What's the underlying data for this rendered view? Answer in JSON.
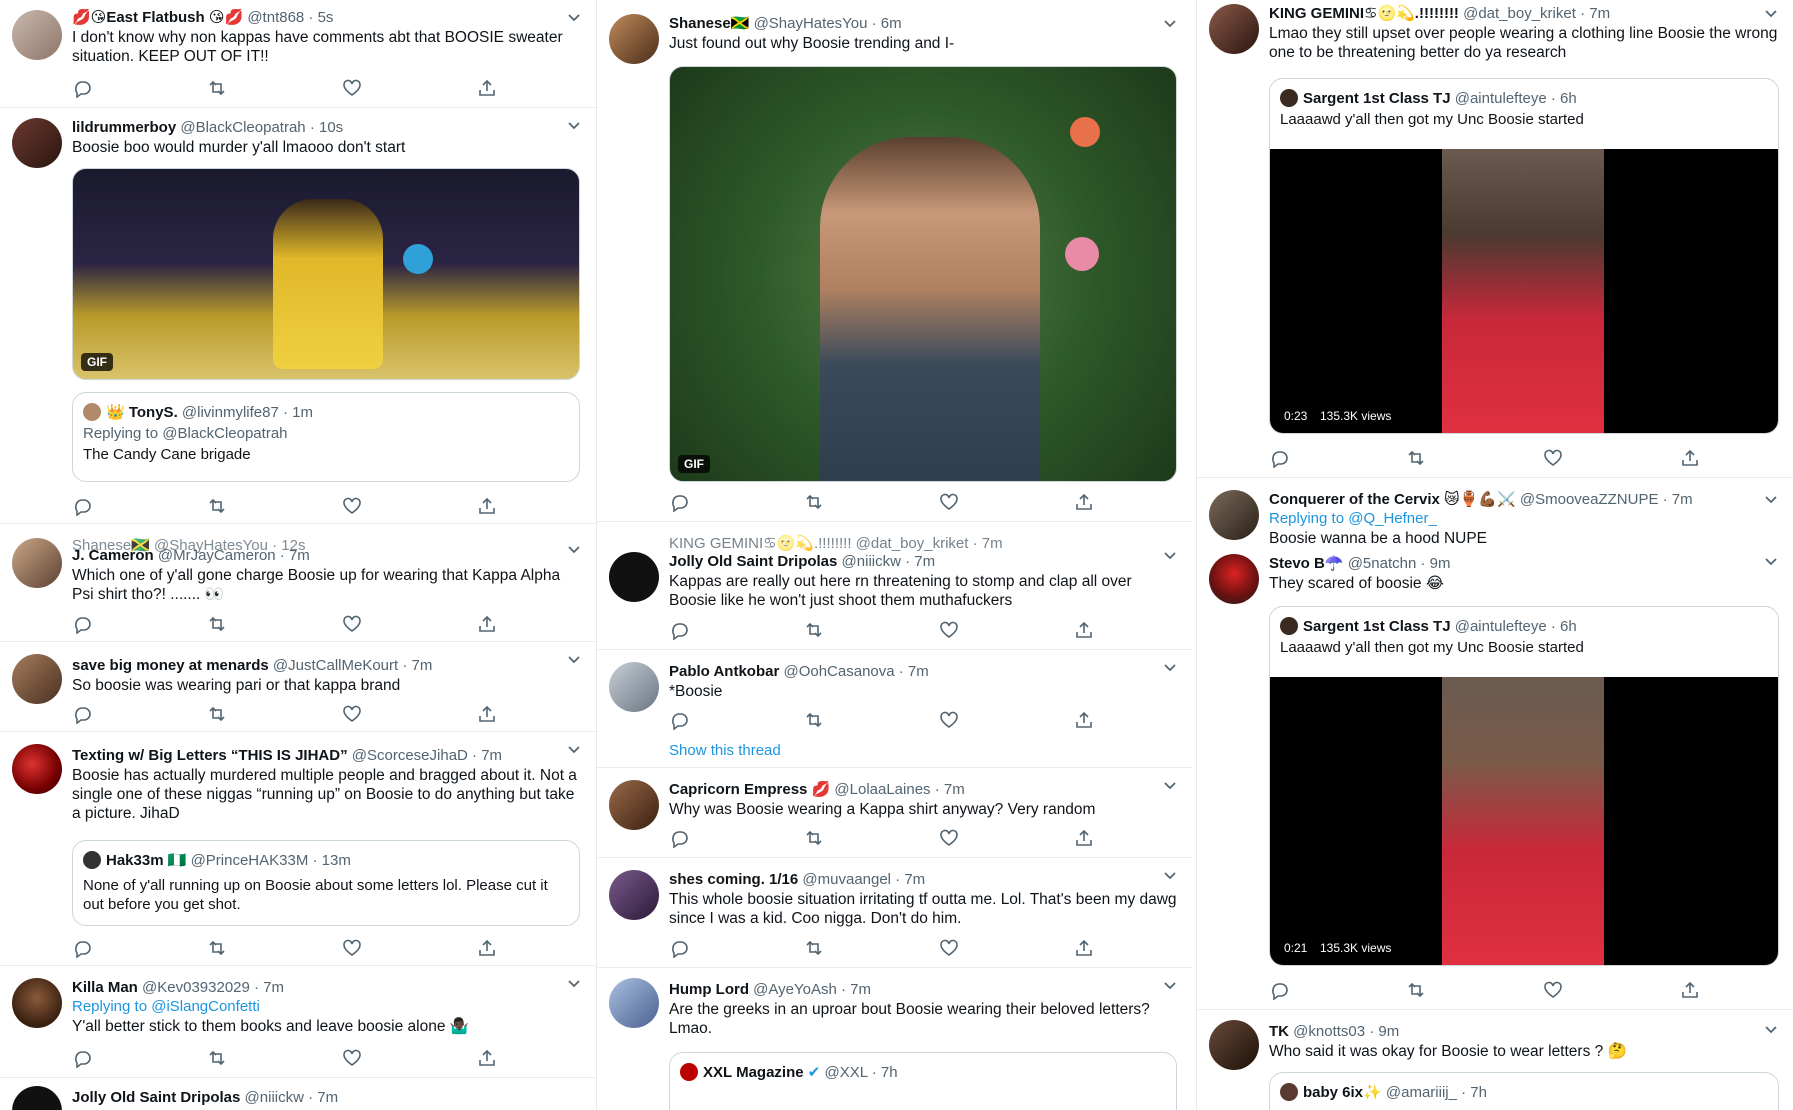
{
  "actions": {
    "reply": "reply-icon",
    "retweet": "retweet-icon",
    "like": "heart-icon",
    "share": "share-icon"
  },
  "colors": {
    "link": "#1b95e0",
    "muted": "#536471",
    "border": "#e6ecf0",
    "text": "#0f1419"
  },
  "col0": {
    "t1": {
      "name": "💋😘East Flatbush 😘💋",
      "handle": "@tnt868 · 5s",
      "text": "I don't know why non kappas have comments abt that BOOSIE sweater situation.  KEEP OUT OF IT!!"
    },
    "t2": {
      "name": "lildrummerboy",
      "handle": "@BlackCleopatrah · 10s",
      "text": "Boosie boo would murder y'all lmaooo don't start",
      "gif": "GIF",
      "quote": {
        "name": "👑 TonyS.",
        "handle": "@livinmylife87 · 1m",
        "reply": "Replying to @BlackCleopatrah",
        "text": "The Candy Cane brigade"
      }
    },
    "t3": {
      "ghost": "Shanese🇯🇲 @ShayHatesYou · 12s",
      "name": "J. Cameron",
      "handle": "@MrJayCameron · 7m",
      "text": "Which one of y'all gone charge Boosie up for wearing that Kappa Alpha Psi shirt tho?! ....... 👀"
    },
    "t4": {
      "name": "save big money at menards",
      "handle": "@JustCallMeKourt · 7m",
      "text": "So boosie was wearing pari or that kappa brand"
    },
    "t5": {
      "name": "Texting w/ Big Letters “THIS IS JIHAD”",
      "handle": "@ScorceseJihaD · 7m",
      "text": "Boosie has actually murdered multiple people and bragged about it. Not a single one of these niggas “running up” on Boosie to do anything but take a picture. JihaD",
      "quote": {
        "name": "Hak33m 🇳🇬",
        "handle": "@PrinceHAK33M · 13m",
        "text": "None of y'all running up on Boosie about some letters lol. Please cut it out before you get shot."
      }
    },
    "t6": {
      "name": "Killa Man",
      "handle": "@Kev03932029 · 7m",
      "reply": "Replying to @iSlangConfetti",
      "text": "Y'all better stick to them books and leave boosie alone 🤷🏿‍♂️"
    },
    "t7": {
      "name": "Jolly Old Saint Dripolas",
      "handle": "@niiickw · 7m"
    }
  },
  "col1": {
    "t1": {
      "name": "Shanese🇯🇲",
      "handle": "@ShayHatesYou · 6m",
      "text": "Just found out why Boosie trending and I-",
      "gif": "GIF"
    },
    "t2": {
      "ghost": "KING GEMINI♋🌝💫.!!!!!!!! @dat_boy_kriket · 7m",
      "name": "Jolly Old Saint Dripolas",
      "handle": "@niiickw · 7m",
      "text": "Kappas are really out here rn threatening to stomp and clap all over Boosie  like he won't just shoot them muthafuckers"
    },
    "t3": {
      "name": "Pablo Antkobar",
      "handle": "@OohCasanova · 7m",
      "text": "*Boosie",
      "thread": "Show this thread"
    },
    "t4": {
      "name": "Capricorn Empress 💋",
      "handle": "@LolaaLaines · 7m",
      "text": "Why was Boosie wearing a Kappa shirt anyway? Very random"
    },
    "t5": {
      "name": "shes coming. 1/16",
      "handle": "@muvaangel · 7m",
      "text": "This whole boosie situation irritating tf outta me. Lol. That's been my dawg since I was a kid. Coo nigga. Don't do him."
    },
    "t6": {
      "name": "Hump Lord",
      "handle": "@AyeYoAsh · 7m",
      "text": "Are the greeks in an uproar bout Boosie wearing their beloved letters? Lmao.",
      "quote": {
        "name": "XXL Magazine",
        "handle": "@XXL · 7h"
      }
    }
  },
  "col2": {
    "t1": {
      "name": "KING GEMINI♋🌝💫.!!!!!!!!",
      "handle": "@dat_boy_kriket · 7m",
      "text": "Lmao  they still upset over people wearing a clothing line Boosie the wrong one to be threatening better do ya research",
      "quote": {
        "name": "Sargent 1st Class TJ",
        "handle": "@aintulefteye · 6h",
        "text": "Laaaawd y'all then got my Unc Boosie started",
        "time": "0:23",
        "views": "135.3K views"
      }
    },
    "t2": {
      "name": "Conquerer of the Cervix 😿🏺💪🏾⚔️",
      "handle": "@SmooveaZZNUPE · 7m",
      "reply": "Replying to @Q_Hefner_",
      "text": "Boosie wanna be a hood NUPE"
    },
    "t3": {
      "name": "Stevo B☂️",
      "handle": "@5natchn · 9m",
      "text": "They scared of boosie 😂",
      "quote": {
        "name": "Sargent 1st Class TJ",
        "handle": "@aintulefteye · 6h",
        "text": "Laaaawd y'all then got my Unc Boosie started",
        "time": "0:21",
        "views": "135.3K views"
      }
    },
    "t4": {
      "name": "TK",
      "handle": "@knotts03 · 9m",
      "text": "Who said it was okay for Boosie to wear letters ? 🤔",
      "quote": {
        "name": "baby 6ix✨",
        "handle": "@amariiij_ · 7h"
      }
    }
  }
}
